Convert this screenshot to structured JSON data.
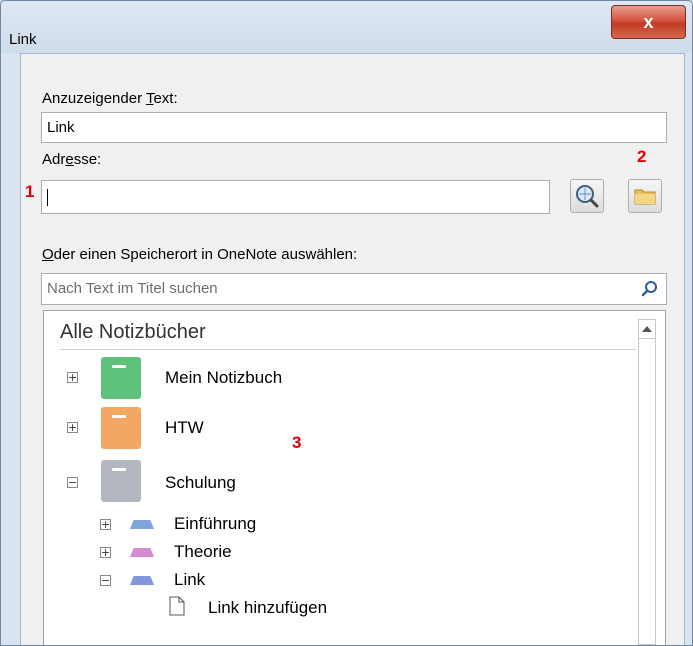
{
  "window": {
    "title": "Link",
    "close_glyph": "x"
  },
  "display_text": {
    "label_pre": "Anzuzeigender ",
    "label_u": "T",
    "label_post": "ext:",
    "value": "Link"
  },
  "address": {
    "label_pre": "Adr",
    "label_u": "e",
    "label_post": "sse:",
    "value": ""
  },
  "markers": {
    "m1": "1",
    "m2": "2",
    "m3": "3"
  },
  "location": {
    "label_u": "O",
    "label_post": "der einen Speicherort in OneNote auswählen:"
  },
  "search": {
    "placeholder": "Nach Text im Titel suchen"
  },
  "tree": {
    "heading": "Alle Notizbücher",
    "notebooks": [
      {
        "name": "Mein Notizbuch",
        "expander": "+",
        "color": "#5ec27a"
      },
      {
        "name": "HTW",
        "expander": "+",
        "color": "#f2a862"
      },
      {
        "name": "Schulung",
        "expander": "−",
        "color": "#b3b8c0"
      }
    ],
    "sections": [
      {
        "name": "Einführung",
        "expander": "+",
        "color": "#7fa6dc"
      },
      {
        "name": "Theorie",
        "expander": "+",
        "color": "#d68bd1"
      },
      {
        "name": "Link",
        "expander": "−",
        "color": "#7f98dc"
      }
    ],
    "pages": [
      {
        "name": "Link hinzufügen"
      }
    ]
  }
}
